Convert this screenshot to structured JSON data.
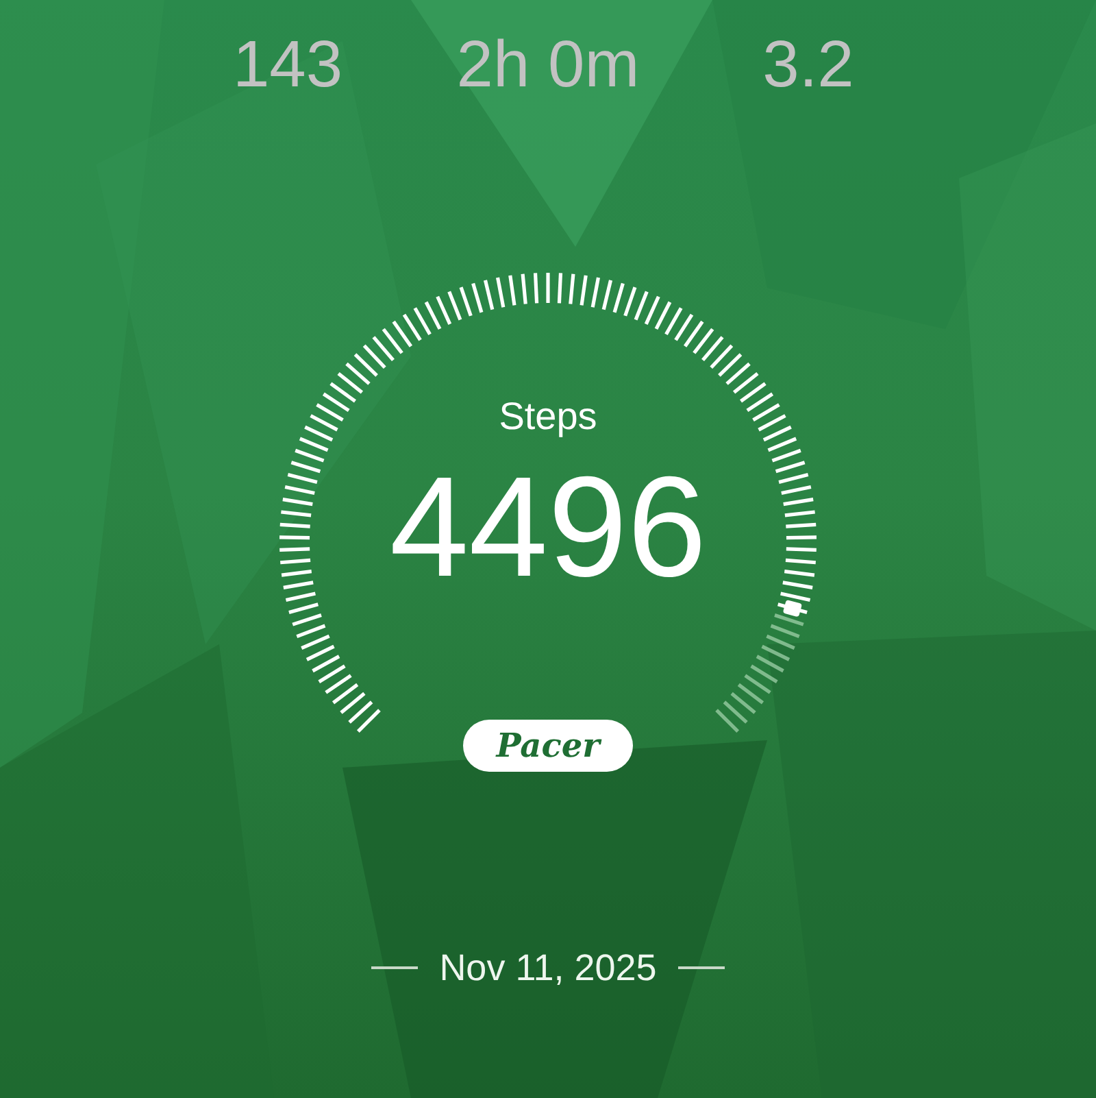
{
  "stats": [
    {
      "value": "143"
    },
    {
      "value": "2h 0m"
    },
    {
      "value": "3.2"
    }
  ],
  "steps": {
    "label": "Steps",
    "value": "4496"
  },
  "brand": "Pacer",
  "date": "Nov 11, 2025"
}
